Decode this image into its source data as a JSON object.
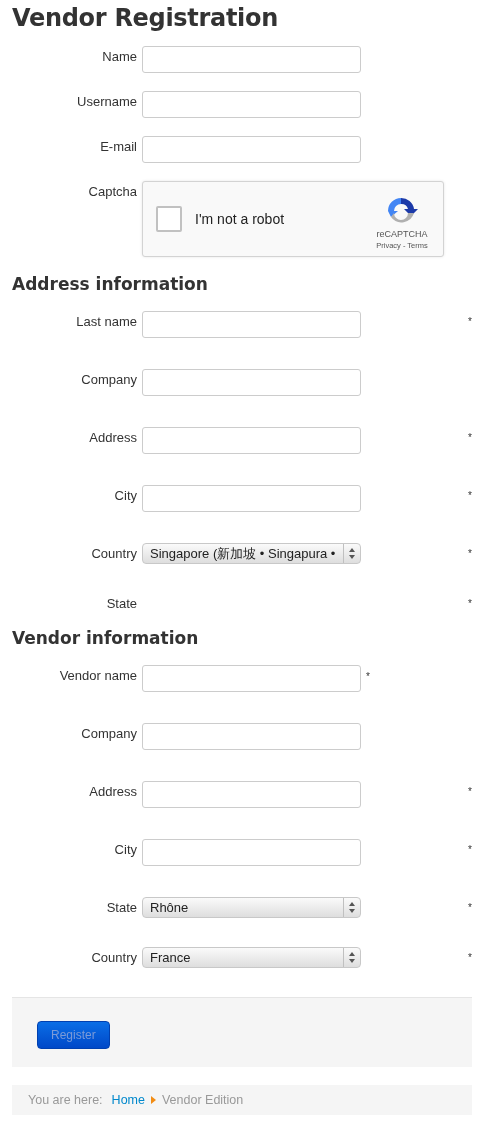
{
  "title": "Vendor Registration",
  "account_fields": [
    {
      "label": "Name",
      "kind": "text"
    },
    {
      "label": "Username",
      "kind": "text"
    },
    {
      "label": "E-mail",
      "kind": "text"
    },
    {
      "label": "Captcha",
      "kind": "captcha",
      "checkbox_label": "I'm not a robot",
      "checked": false,
      "brand": "reCAPTCHA",
      "links": "Privacy - Terms"
    }
  ],
  "address": {
    "heading": "Address information",
    "fields": [
      {
        "label": "Last name",
        "kind": "text",
        "required_mark": "*"
      },
      {
        "label": "Company",
        "kind": "text"
      },
      {
        "label": "Address",
        "kind": "text",
        "required_mark": "*"
      },
      {
        "label": "City",
        "kind": "text",
        "required_mark": "*"
      },
      {
        "label": "Country",
        "kind": "select",
        "value": "Singapore (新加坡 • Singapura •",
        "required_mark": "*"
      },
      {
        "label": "State",
        "kind": "none",
        "required_mark": "*"
      }
    ]
  },
  "vendor": {
    "heading": "Vendor information",
    "fields": [
      {
        "label": "Vendor name",
        "kind": "text",
        "required_mark": "*",
        "mark_beside_field": true
      },
      {
        "label": "Company",
        "kind": "text"
      },
      {
        "label": "Address",
        "kind": "text",
        "required_mark": "*"
      },
      {
        "label": "City",
        "kind": "text",
        "required_mark": "*"
      },
      {
        "label": "State",
        "kind": "select",
        "value": "Rhône",
        "required_mark": "*"
      },
      {
        "label": "Country",
        "kind": "select",
        "value": "France",
        "required_mark": "*"
      }
    ]
  },
  "register_button": "Register",
  "breadcrumb": {
    "prefix": "You are here:",
    "items": [
      {
        "label": "Home",
        "link": true
      },
      {
        "label": "Vendor Edition",
        "link": false
      }
    ]
  }
}
